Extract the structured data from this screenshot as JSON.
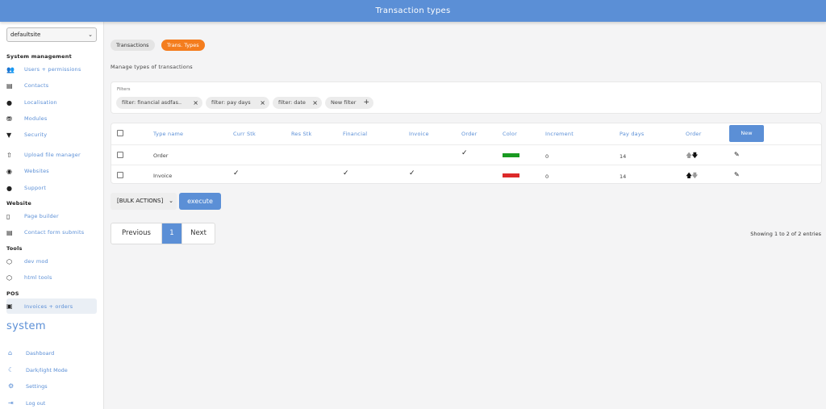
{
  "header": {
    "title": "Transaction types"
  },
  "sidebar": {
    "site": "defaultsite",
    "sections": {
      "system_management": "System management",
      "website": "Website",
      "tools": "Tools",
      "pos": "POS"
    },
    "items": {
      "users": "Users + permissions",
      "contacts": "Contacts",
      "localisation": "Localisation",
      "modules": "Modules",
      "security": "Security",
      "upload": "Upload file manager",
      "websites": "Websites",
      "support": "Support",
      "page_builder": "Page builder",
      "contact_forms": "Contact form submits",
      "dev_mod": "dev mod",
      "html_tools": "html tools",
      "invoices": "Invoices + orders"
    },
    "system_title": "system",
    "footer": {
      "dashboard": "Dashboard",
      "dark_light": "Dark/light Mode",
      "settings": "Settings",
      "logout": "Log out"
    }
  },
  "tabs": {
    "transactions": "Transactions",
    "types": "Trans. Types"
  },
  "subtitle": "Manage types of transactions",
  "filters": {
    "label": "Filters",
    "chips": {
      "financial": "filter: financial asdfas..",
      "pay_days": "filter: pay days",
      "date": "filter: date",
      "new": "New filter"
    }
  },
  "table": {
    "headers": {
      "type_name": "Type name",
      "curr_stk": "Curr Stk",
      "res_stk": "Res Stk",
      "financial": "Financial",
      "invoice": "Invoice",
      "order": "Order",
      "color": "Color",
      "increment": "Increment",
      "pay_days": "Pay days",
      "order_sort": "Order"
    },
    "new_button": "New",
    "rows": [
      {
        "name": "Order",
        "curr_stk": false,
        "res_stk": false,
        "financial": false,
        "invoice": false,
        "order": true,
        "color": "#1a9a22",
        "increment": "0",
        "pay_days": "14"
      },
      {
        "name": "Invoice",
        "curr_stk": true,
        "res_stk": false,
        "financial": true,
        "invoice": true,
        "order": false,
        "color": "#dc2a2a",
        "increment": "0",
        "pay_days": "14"
      }
    ]
  },
  "bulk": {
    "label": "[BULK ACTIONS]",
    "execute": "execute"
  },
  "pagination": {
    "previous": "Previous",
    "current": "1",
    "next": "Next",
    "showing": "Showing 1 to 2 of 2 entries"
  },
  "colors": {
    "accent": "#5b8fd6",
    "orange": "#f47d1e"
  }
}
